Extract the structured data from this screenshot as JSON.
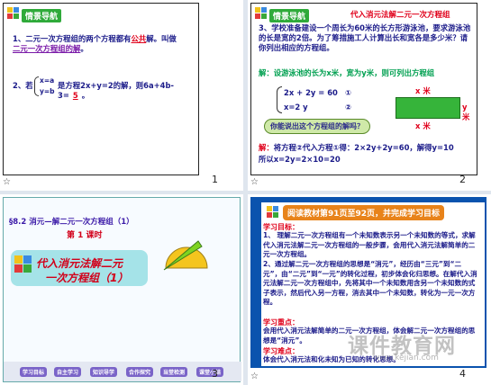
{
  "slides": [
    {
      "number": "1",
      "tag": "情景导航",
      "q1_prefix": "1、二元一次方程组的两个方程都有",
      "q1_answer": "公共",
      "q1_mid": "解。叫做",
      "q1_term": "二元一次方程组的解",
      "q1_end": "。",
      "q2_prefix": "2、若",
      "q2_sys_a": "x=a",
      "q2_sys_b": "y=b",
      "q2_mid": "是方程2x+y=2的解，则6a+4b-3=",
      "q2_answer": "5",
      "q2_end": "。"
    },
    {
      "number": "2",
      "tag": "情景导航",
      "header": "代入消元法解二元一次方程组",
      "problem": "3、学校准备建设一个周长为60米的长方形游泳池，要求游泳池的长是宽的2倍。为了筹措施工人计算出长和宽各是多少米？请你列出相应的方程组。",
      "solve_label": "解：设游泳池的长为x米，宽为y米，则可列出方程组",
      "eq1": "2x + 2y = 60",
      "eq1_no": "①",
      "eq2": "x=2 y",
      "eq2_no": "②",
      "bubble": "你能说出这个方程组的解吗？",
      "x_top": "x 米",
      "y_side": "y 米",
      "x_bottom": "x 米",
      "solution_prefix": "解：",
      "solution": "将方程②代入方程①得：2×2y+2y=60，解得y=10",
      "solution2": "所以x=2y=2×10=20"
    },
    {
      "number": "3",
      "title": "§8.2 消元—解二元一次方程组（1）",
      "subtitle": "第 1 课时",
      "banner_line1": "代入消元法解二元",
      "banner_line2": "一次方程组（1）",
      "nav_buttons": [
        "学习目标",
        "自主学习",
        "知识导学",
        "合作探究",
        "当堂检测",
        "课堂小结"
      ]
    },
    {
      "number": "4",
      "tag": "阅读教材第91页至92页，并完成学习目标",
      "goal_title": "学习目标：",
      "goal1": "1、 理解二元一次方程组有一个未知数表示另一个未知数的等式，求解代入消元法解二元一次方程组的一般步骤，会用代入消元法解简单的二元一次方程组。",
      "goal2": "2、通过解二元一次方程组的思想是“消元”，经历由“三元”到“二元”，由“二元”到“一元”的转化过程，初步体会化归思想。在解代入消元法解二元一次方程组中，先将其中一个未知数用含另一个未知数的式子表示，然后代入另一方程，消去其中一个未知数，转化为一元一次方程。",
      "key_title": "学习重点：",
      "key_text": "会用代入消元法解简单的二元一次方程组，体会解二元一次方程组的思想是“消元”。",
      "diff_title": "学习难点：",
      "diff_text": "体会代入消元法和化未知为已知的转化思想。",
      "watermark": "课件教育网",
      "watermark_sub": "www.kejian.com"
    }
  ],
  "colors": {
    "frame_blue": "#0a53ae",
    "tag_green": "#2faa3a",
    "text_blue": "#1c1c8a",
    "answer_red": "#e0001a",
    "banner_cyan": "#a5e3e8",
    "orange": "#e8831a"
  },
  "icons": {
    "slide_corner": "star-icon",
    "cubes": "colored-cubes-icon",
    "triangle_ruler": "protractor-icon"
  }
}
